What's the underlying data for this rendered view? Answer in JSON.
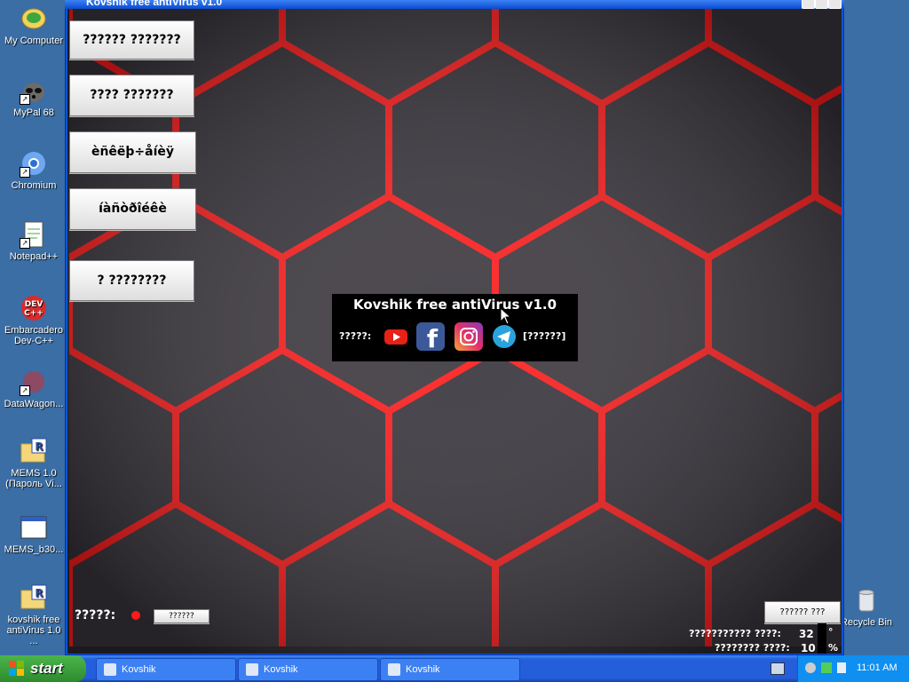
{
  "desktop": {
    "icons": [
      {
        "label": "My Computer",
        "icon": "computer-icon"
      },
      {
        "label": "MyPal 68",
        "icon": "raccoon-icon"
      },
      {
        "label": "Chromium",
        "icon": "chromium-icon"
      },
      {
        "label": "Notepad++",
        "icon": "notepad-icon"
      },
      {
        "label": "Embarcadero Dev-C++",
        "icon": "devcpp-icon"
      },
      {
        "label": "DataWagon...",
        "icon": "datawagon-icon"
      },
      {
        "label": "MEMS 1.0 (Пароль Vi...",
        "icon": "r-folder-icon"
      },
      {
        "label": "MEMS_b30...",
        "icon": "window-app-icon"
      },
      {
        "label": "kovshik free antiVirus 1.0 ...",
        "icon": "r-folder-icon"
      }
    ],
    "recycle_bin": "Recycle Bin"
  },
  "window": {
    "title": "Kovshik free antiVirus v1.0",
    "side_buttons": [
      "?????? ???????",
      "???? ???????",
      "èñêëþ÷åíèÿ",
      "íàñòðîéêè",
      "? ????????"
    ],
    "panel": {
      "title": "Kovshik free antiVirus v1.0",
      "label": "?????:",
      "bracket": "[??????]",
      "social_icons": [
        "youtube-icon",
        "facebook-icon",
        "instagram-icon",
        "telegram-icon"
      ]
    },
    "bottom_left": {
      "label": "?????:",
      "button": "??????"
    },
    "bottom_right": {
      "button": "?????? ???",
      "stat1_label": "??????????? ????:",
      "stat1_value": "32",
      "stat1_unit": "°",
      "stat2_label": "???????? ????:",
      "stat2_value": "10",
      "stat2_unit": "%"
    }
  },
  "taskbar": {
    "start": "start",
    "tasks": [
      "Kovshik",
      "Kovshik",
      "Kovshik"
    ],
    "time": "11:01 AM"
  },
  "colors": {
    "accent_red": "#ff1a1a",
    "desktop_bg": "#3a6ea5",
    "taskbar_blue": "#245edb",
    "start_green": "#3a9b3a"
  }
}
